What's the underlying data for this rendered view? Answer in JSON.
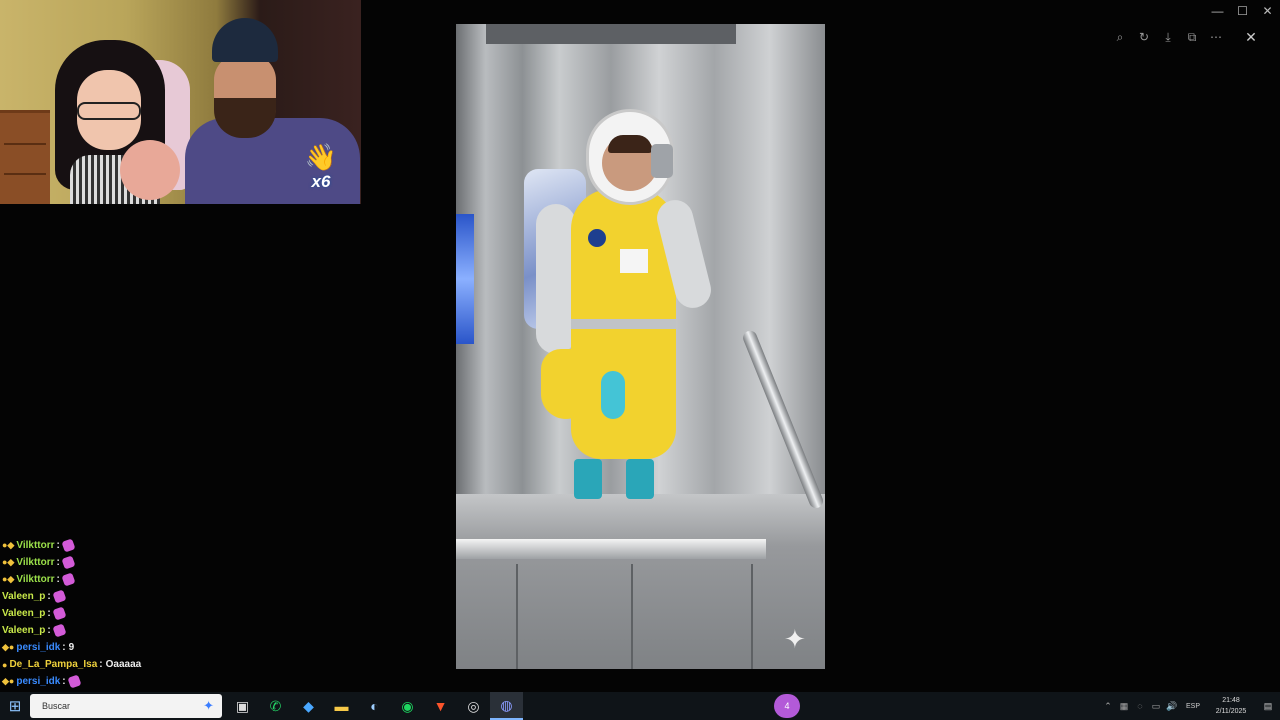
{
  "window": {
    "controls": {
      "minimize": "—",
      "maximize": "☐",
      "close": "✕"
    }
  },
  "photo_viewer": {
    "toolbar": [
      {
        "icon": "zoom-icon",
        "glyph": "⌕"
      },
      {
        "icon": "rotate-icon",
        "glyph": "↻"
      },
      {
        "icon": "download-icon",
        "glyph": "⤓"
      },
      {
        "icon": "open-external-icon",
        "glyph": "⧉"
      },
      {
        "icon": "more-icon",
        "glyph": "⋯"
      }
    ],
    "close_glyph": "✕",
    "sparkle_glyph": "✦"
  },
  "webcam": {
    "badge_glyph": "👋",
    "badge_count": "x6"
  },
  "chat": {
    "messages": [
      {
        "badges": "●◆",
        "user": "Vilkttorr",
        "color": "#9be04a",
        "text": "",
        "emote": true
      },
      {
        "badges": "●◆",
        "user": "Vilkttorr",
        "color": "#9be04a",
        "text": "",
        "emote": true
      },
      {
        "badges": "●◆",
        "user": "Vilkttorr",
        "color": "#9be04a",
        "text": "",
        "emote": true
      },
      {
        "badges": "",
        "user": "Valeen_p",
        "color": "#c8e84a",
        "text": "",
        "emote": true
      },
      {
        "badges": "",
        "user": "Valeen_p",
        "color": "#c8e84a",
        "text": "",
        "emote": true
      },
      {
        "badges": "",
        "user": "Valeen_p",
        "color": "#c8e84a",
        "text": "",
        "emote": true
      },
      {
        "badges": "◆●",
        "user": "persi_idk",
        "color": "#3a8bff",
        "text": "9",
        "emote": false
      },
      {
        "badges": "●",
        "user": "De_La_Pampa_Isa",
        "color": "#f0d23c",
        "text": "Oaaaaa",
        "emote": false
      },
      {
        "badges": "◆●",
        "user": "persi_idk",
        "color": "#3a8bff",
        "text": "",
        "emote": true
      }
    ],
    "separator": ":"
  },
  "taskbar": {
    "start_glyph": "⊞",
    "search_placeholder": "Buscar",
    "search_gem": "✦",
    "apps": [
      {
        "name": "task-view",
        "glyph": "▣",
        "color": "#ddd"
      },
      {
        "name": "whatsapp",
        "glyph": "✆",
        "color": "#25d366"
      },
      {
        "name": "copilot",
        "glyph": "◆",
        "color": "#4aa8ff"
      },
      {
        "name": "file-explorer",
        "glyph": "▬",
        "color": "#f7c948"
      },
      {
        "name": "steam",
        "glyph": "◐",
        "color": "#9ecfff"
      },
      {
        "name": "spotify",
        "glyph": "◉",
        "color": "#1ed760"
      },
      {
        "name": "brave",
        "glyph": "▼",
        "color": "#fb542b"
      },
      {
        "name": "obs",
        "glyph": "◎",
        "color": "#ddd"
      },
      {
        "name": "discord",
        "glyph": "◍",
        "color": "#8b9cff"
      }
    ],
    "pill_label": "4",
    "tray_icons": [
      "⌃",
      "▦",
      "◌",
      "▭",
      "🔊"
    ],
    "language": "ESP",
    "time": "21:48",
    "date": "2/11/2025",
    "notification_glyph": "▤"
  }
}
